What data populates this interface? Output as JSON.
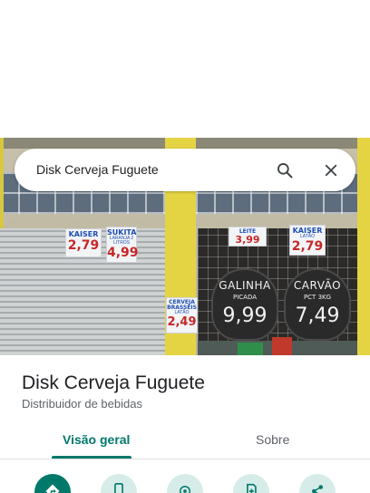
{
  "search": {
    "query": "Disk Cerveja Fuguete"
  },
  "photo": {
    "signs": [
      {
        "title": "KAISER",
        "subtitle": "",
        "price": "2,79"
      },
      {
        "title": "SUKITA",
        "subtitle": "LARANJA 2 LITROS",
        "price": "4,99"
      },
      {
        "title": "LEITE",
        "subtitle": "",
        "price": "3,99"
      },
      {
        "title": "KAISER",
        "subtitle": "LATÃO",
        "price": "2,79"
      },
      {
        "title": "CERVEJA BRASSEIS",
        "subtitle": "LATÃO",
        "price": "2,49"
      }
    ],
    "boards": [
      {
        "title": "GALINHA",
        "subtitle": "PICADA",
        "price": "9,99",
        "footer": ""
      },
      {
        "title": "CARVÃO",
        "subtitle": "PCT 3KG",
        "price": "7,49",
        "footer": ""
      }
    ]
  },
  "place": {
    "name": "Disk Cerveja Fuguete",
    "category": "Distribuidor de bebidas"
  },
  "tabs": {
    "overview": "Visão geral",
    "about": "Sobre",
    "active": "overview"
  },
  "actions": [
    {
      "icon": "directions-icon"
    },
    {
      "icon": "phone-icon"
    },
    {
      "icon": "location-icon"
    },
    {
      "icon": "save-icon"
    },
    {
      "icon": "share-icon"
    }
  ],
  "colors": {
    "accent": "#00796b",
    "accent_light": "#d6ece8",
    "text_primary": "#202124",
    "text_secondary": "#5f6368"
  }
}
